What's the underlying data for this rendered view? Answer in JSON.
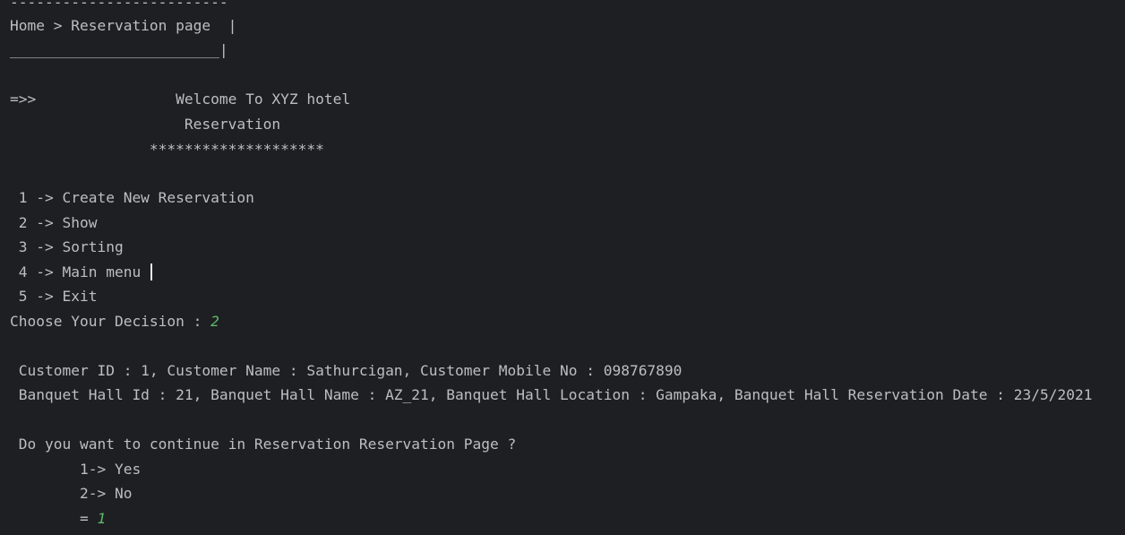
{
  "breadcrumb": {
    "rule_top": "-------------------------",
    "text": "Home > Reservation page  |",
    "rule_bottom": "________________________|"
  },
  "banner": {
    "arrow": "=>>",
    "line1": "                Welcome To XYZ hotel",
    "line2": "                    Reservation",
    "line3": "                ********************"
  },
  "menu": {
    "items": [
      " 1 -> Create New Reservation",
      " 2 -> Show",
      " 3 -> Sorting",
      " 4 -> Main menu ",
      " 5 -> Exit"
    ]
  },
  "prompt": {
    "label": "Choose Your Decision : ",
    "value": "2"
  },
  "record": {
    "customer": " Customer ID : 1, Customer Name : Sathurcigan, Customer Mobile No : 098767890",
    "hall": " Banquet Hall Id : 21, Banquet Hall Name : AZ_21, Banquet Hall Location : Gampaka, Banquet Hall Reservation Date : 23/5/2021"
  },
  "continue_prompt": {
    "question": " Do you want to continue in Reservation Reservation Page ?",
    "options": [
      "        1-> Yes",
      "        2-> No"
    ],
    "entry_label": "        = ",
    "entry_value": "1"
  },
  "colors": {
    "background": "#1e1f22",
    "text": "#bcbec4",
    "user_input": "#5fb86b"
  }
}
